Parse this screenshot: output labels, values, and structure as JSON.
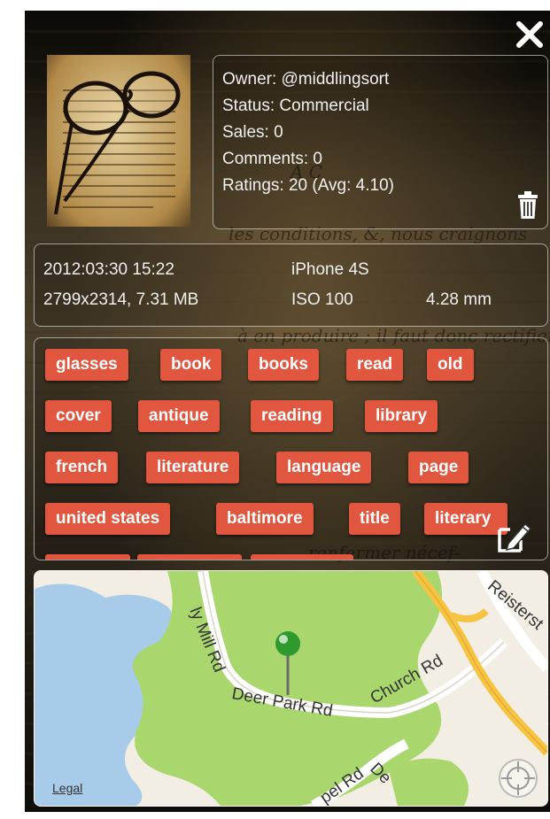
{
  "owner": "Owner: @middlingsort",
  "status": "Status: Commercial",
  "sales": "Sales: 0",
  "comments": "Comments: 0",
  "ratings": "Ratings: 20 (Avg: 4.10)",
  "meta": {
    "datetime": "2012:03:30 15:22",
    "camera": "iPhone 4S",
    "dimensions": "2799x2314, 7.31 MB",
    "iso": "ISO 100",
    "focal": "4.28 mm"
  },
  "tags": [
    "glasses",
    "book",
    "books",
    "read",
    "old",
    "cover",
    "antique",
    "reading",
    "library",
    "french",
    "literature",
    "language",
    "page",
    "united states",
    "baltimore",
    "title",
    "literary"
  ],
  "map": {
    "legal": "Legal",
    "roads": [
      "Deer Park Rd",
      "Church Rd",
      "Reisterst",
      "ly Mill Rd",
      "pel Rd",
      "De"
    ]
  },
  "colors": {
    "tag": "#e0563f",
    "park": "#a9d76e",
    "water": "#a7cbe8",
    "highway": "#f6c342",
    "pin": "#2e9a2e"
  }
}
